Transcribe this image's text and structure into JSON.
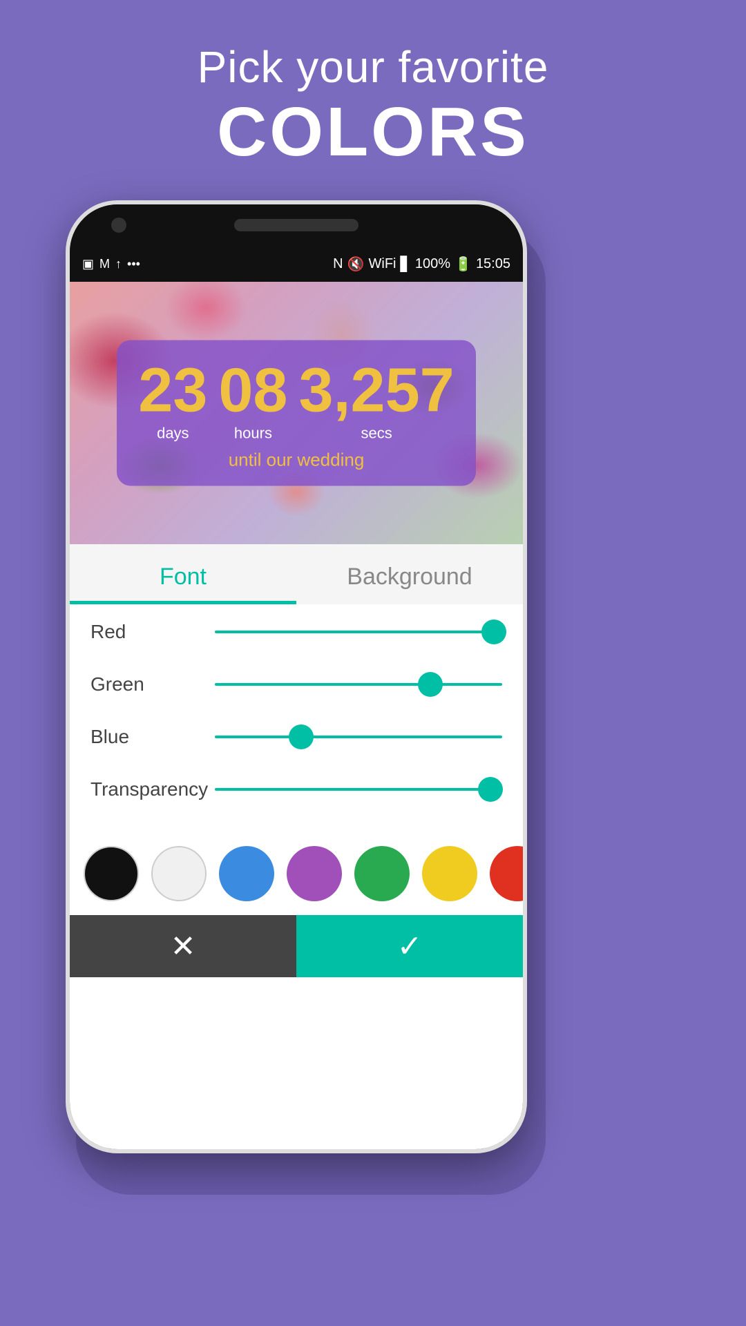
{
  "page": {
    "bg_color": "#7b6bbf"
  },
  "header": {
    "subtitle": "Pick your favorite",
    "title": "COLORS"
  },
  "status_bar": {
    "time": "15:05",
    "battery": "100%",
    "icons_left": "▣ M ▲ •••",
    "icons_right": "N 🔇 WiFi ▋ 100% 🔋 15:05"
  },
  "countdown": {
    "days_value": "23",
    "days_label": "days",
    "hours_value": "08",
    "hours_label": "hours",
    "secs_value": "3,257",
    "secs_label": "secs",
    "message": "until our wedding"
  },
  "tabs": {
    "font_label": "Font",
    "background_label": "Background",
    "active": "font"
  },
  "sliders": [
    {
      "label": "Red",
      "value": 100,
      "position_pct": 97
    },
    {
      "label": "Green",
      "value": 80,
      "position_pct": 75
    },
    {
      "label": "Blue",
      "value": 35,
      "position_pct": 30
    },
    {
      "label": "Transparency",
      "value": 95,
      "position_pct": 96
    }
  ],
  "swatches": [
    {
      "color": "#111111",
      "name": "black"
    },
    {
      "color": "#f0f0f0",
      "name": "white"
    },
    {
      "color": "#3b8be0",
      "name": "blue"
    },
    {
      "color": "#a050b8",
      "name": "purple"
    },
    {
      "color": "#2aaa50",
      "name": "green"
    },
    {
      "color": "#f0cc20",
      "name": "yellow"
    },
    {
      "color": "#e03020",
      "name": "red"
    },
    {
      "color": "#f07820",
      "name": "orange"
    }
  ],
  "bottom_bar": {
    "cancel_icon": "✕",
    "confirm_icon": "✓"
  }
}
